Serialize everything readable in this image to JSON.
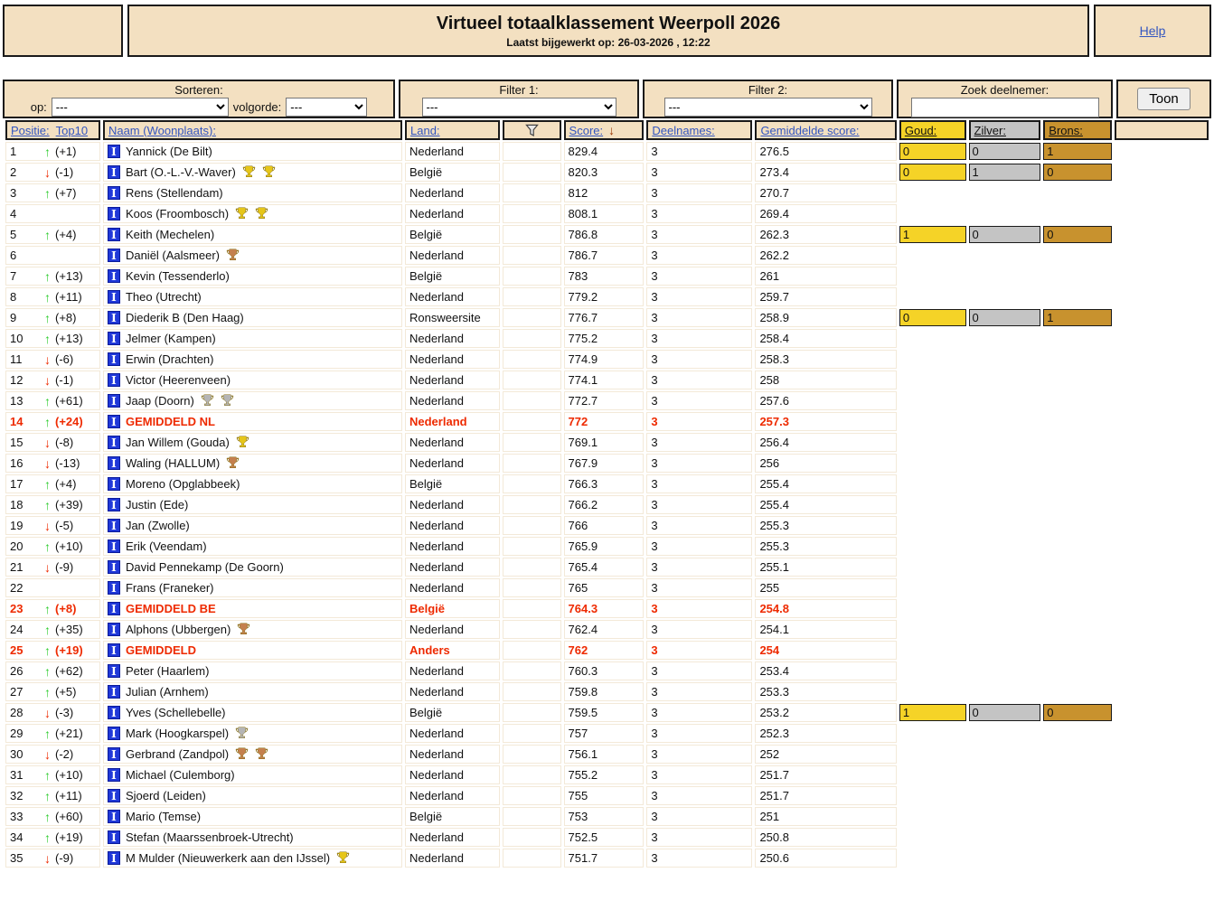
{
  "header": {
    "title": "Virtueel totaalklassement Weerpoll 2026",
    "subtitle": "Laatst bijgewerkt op: 26-03-2026 , 12:22",
    "help_label": "Help"
  },
  "controls": {
    "sorteren": {
      "label": "Sorteren:",
      "op_label": "op:",
      "op_value": "---",
      "volgorde_label": "volgorde:",
      "volgorde_value": "---"
    },
    "filter1": {
      "label": "Filter 1:",
      "value": "---"
    },
    "filter2": {
      "label": "Filter 2:",
      "value": "---"
    },
    "zoek": {
      "label": "Zoek deelnemer:",
      "value": ""
    },
    "toon_label": "Toon"
  },
  "icons": {
    "up_arrow": "↑",
    "down_arrow": "↓",
    "sort_desc_arrow": "↓",
    "funnel": "filter-funnel",
    "stat_glyph": "I"
  },
  "colors": {
    "beige": "#f3e0c1",
    "gold": "#f5d327",
    "silver": "#c4c4c4",
    "bronze": "#c8922e",
    "highlight_red": "#ee2a00",
    "up_green": "#2ecc2e",
    "link_blue": "#3356c0",
    "trophy_gold": "#e6c619",
    "trophy_silver": "#b5b5b5",
    "trophy_bronze": "#c4804e"
  },
  "table": {
    "headers": {
      "positie": "Positie:",
      "top10": "Top10",
      "naam": "Naam (Woonplaats):",
      "land": "Land:",
      "score": "Score:",
      "deelnames": "Deelnames:",
      "gemiddelde": "Gemiddelde score:",
      "goud": "Goud:",
      "zilver": "Zilver:",
      "brons": "Brons:"
    },
    "rows": [
      {
        "pos": "1",
        "dir": "up",
        "delta": "(+1)",
        "name": "Yannick (De Bilt)",
        "trophies": [],
        "land": "Nederland",
        "score": "829.4",
        "deelnames": "3",
        "avg": "276.5",
        "medals": [
          "0",
          "0",
          "1"
        ],
        "hl": false
      },
      {
        "pos": "2",
        "dir": "down",
        "delta": "(-1)",
        "name": "Bart (O.-L.-V.-Waver)",
        "trophies": [
          "gold",
          "gold"
        ],
        "land": "België",
        "score": "820.3",
        "deelnames": "3",
        "avg": "273.4",
        "medals": [
          "0",
          "1",
          "0"
        ],
        "hl": false
      },
      {
        "pos": "3",
        "dir": "up",
        "delta": "(+7)",
        "name": "Rens (Stellendam)",
        "trophies": [],
        "land": "Nederland",
        "score": "812",
        "deelnames": "3",
        "avg": "270.7",
        "medals": null,
        "hl": false
      },
      {
        "pos": "4",
        "dir": null,
        "delta": "",
        "name": "Koos (Froombosch)",
        "trophies": [
          "gold",
          "gold"
        ],
        "land": "Nederland",
        "score": "808.1",
        "deelnames": "3",
        "avg": "269.4",
        "medals": null,
        "hl": false
      },
      {
        "pos": "5",
        "dir": "up",
        "delta": "(+4)",
        "name": "Keith (Mechelen)",
        "trophies": [],
        "land": "België",
        "score": "786.8",
        "deelnames": "3",
        "avg": "262.3",
        "medals": [
          "1",
          "0",
          "0"
        ],
        "hl": false
      },
      {
        "pos": "6",
        "dir": null,
        "delta": "",
        "name": "Daniël (Aalsmeer)",
        "trophies": [
          "bronze"
        ],
        "land": "Nederland",
        "score": "786.7",
        "deelnames": "3",
        "avg": "262.2",
        "medals": null,
        "hl": false
      },
      {
        "pos": "7",
        "dir": "up",
        "delta": "(+13)",
        "name": "Kevin (Tessenderlo)",
        "trophies": [],
        "land": "België",
        "score": "783",
        "deelnames": "3",
        "avg": "261",
        "medals": null,
        "hl": false
      },
      {
        "pos": "8",
        "dir": "up",
        "delta": "(+11)",
        "name": "Theo (Utrecht)",
        "trophies": [],
        "land": "Nederland",
        "score": "779.2",
        "deelnames": "3",
        "avg": "259.7",
        "medals": null,
        "hl": false
      },
      {
        "pos": "9",
        "dir": "up",
        "delta": "(+8)",
        "name": "Diederik B (Den Haag)",
        "trophies": [],
        "land": "Ronsweersite",
        "score": "776.7",
        "deelnames": "3",
        "avg": "258.9",
        "medals": [
          "0",
          "0",
          "1"
        ],
        "hl": false
      },
      {
        "pos": "10",
        "dir": "up",
        "delta": "(+13)",
        "name": "Jelmer (Kampen)",
        "trophies": [],
        "land": "Nederland",
        "score": "775.2",
        "deelnames": "3",
        "avg": "258.4",
        "medals": null,
        "hl": false
      },
      {
        "pos": "11",
        "dir": "down",
        "delta": "(-6)",
        "name": "Erwin (Drachten)",
        "trophies": [],
        "land": "Nederland",
        "score": "774.9",
        "deelnames": "3",
        "avg": "258.3",
        "medals": null,
        "hl": false
      },
      {
        "pos": "12",
        "dir": "down",
        "delta": "(-1)",
        "name": "Victor (Heerenveen)",
        "trophies": [],
        "land": "Nederland",
        "score": "774.1",
        "deelnames": "3",
        "avg": "258",
        "medals": null,
        "hl": false
      },
      {
        "pos": "13",
        "dir": "up",
        "delta": "(+61)",
        "name": "Jaap (Doorn)",
        "trophies": [
          "silver",
          "silver"
        ],
        "land": "Nederland",
        "score": "772.7",
        "deelnames": "3",
        "avg": "257.6",
        "medals": null,
        "hl": false
      },
      {
        "pos": "14",
        "dir": "up",
        "delta": "(+24)",
        "name": "GEMIDDELD NL",
        "trophies": [],
        "land": "Nederland",
        "score": "772",
        "deelnames": "3",
        "avg": "257.3",
        "medals": null,
        "hl": true
      },
      {
        "pos": "15",
        "dir": "down",
        "delta": "(-8)",
        "name": "Jan Willem (Gouda)",
        "trophies": [
          "gold"
        ],
        "land": "Nederland",
        "score": "769.1",
        "deelnames": "3",
        "avg": "256.4",
        "medals": null,
        "hl": false
      },
      {
        "pos": "16",
        "dir": "down",
        "delta": "(-13)",
        "name": "Waling (HALLUM)",
        "trophies": [
          "bronze"
        ],
        "land": "Nederland",
        "score": "767.9",
        "deelnames": "3",
        "avg": "256",
        "medals": null,
        "hl": false
      },
      {
        "pos": "17",
        "dir": "up",
        "delta": "(+4)",
        "name": "Moreno (Opglabbeek)",
        "trophies": [],
        "land": "België",
        "score": "766.3",
        "deelnames": "3",
        "avg": "255.4",
        "medals": null,
        "hl": false
      },
      {
        "pos": "18",
        "dir": "up",
        "delta": "(+39)",
        "name": "Justin (Ede)",
        "trophies": [],
        "land": "Nederland",
        "score": "766.2",
        "deelnames": "3",
        "avg": "255.4",
        "medals": null,
        "hl": false
      },
      {
        "pos": "19",
        "dir": "down",
        "delta": "(-5)",
        "name": "Jan (Zwolle)",
        "trophies": [],
        "land": "Nederland",
        "score": "766",
        "deelnames": "3",
        "avg": "255.3",
        "medals": null,
        "hl": false
      },
      {
        "pos": "20",
        "dir": "up",
        "delta": "(+10)",
        "name": "Erik (Veendam)",
        "trophies": [],
        "land": "Nederland",
        "score": "765.9",
        "deelnames": "3",
        "avg": "255.3",
        "medals": null,
        "hl": false
      },
      {
        "pos": "21",
        "dir": "down",
        "delta": "(-9)",
        "name": "David Pennekamp (De Goorn)",
        "trophies": [],
        "land": "Nederland",
        "score": "765.4",
        "deelnames": "3",
        "avg": "255.1",
        "medals": null,
        "hl": false
      },
      {
        "pos": "22",
        "dir": null,
        "delta": "",
        "name": "Frans (Franeker)",
        "trophies": [],
        "land": "Nederland",
        "score": "765",
        "deelnames": "3",
        "avg": "255",
        "medals": null,
        "hl": false
      },
      {
        "pos": "23",
        "dir": "up",
        "delta": "(+8)",
        "name": "GEMIDDELD BE",
        "trophies": [],
        "land": "België",
        "score": "764.3",
        "deelnames": "3",
        "avg": "254.8",
        "medals": null,
        "hl": true
      },
      {
        "pos": "24",
        "dir": "up",
        "delta": "(+35)",
        "name": "Alphons (Ubbergen)",
        "trophies": [
          "bronze"
        ],
        "land": "Nederland",
        "score": "762.4",
        "deelnames": "3",
        "avg": "254.1",
        "medals": null,
        "hl": false
      },
      {
        "pos": "25",
        "dir": "up",
        "delta": "(+19)",
        "name": "GEMIDDELD",
        "trophies": [],
        "land": "Anders",
        "score": "762",
        "deelnames": "3",
        "avg": "254",
        "medals": null,
        "hl": true
      },
      {
        "pos": "26",
        "dir": "up",
        "delta": "(+62)",
        "name": "Peter (Haarlem)",
        "trophies": [],
        "land": "Nederland",
        "score": "760.3",
        "deelnames": "3",
        "avg": "253.4",
        "medals": null,
        "hl": false
      },
      {
        "pos": "27",
        "dir": "up",
        "delta": "(+5)",
        "name": "Julian (Arnhem)",
        "trophies": [],
        "land": "Nederland",
        "score": "759.8",
        "deelnames": "3",
        "avg": "253.3",
        "medals": null,
        "hl": false
      },
      {
        "pos": "28",
        "dir": "down",
        "delta": "(-3)",
        "name": "Yves (Schellebelle)",
        "trophies": [],
        "land": "België",
        "score": "759.5",
        "deelnames": "3",
        "avg": "253.2",
        "medals": [
          "1",
          "0",
          "0"
        ],
        "hl": false
      },
      {
        "pos": "29",
        "dir": "up",
        "delta": "(+21)",
        "name": "Mark (Hoogkarspel)",
        "trophies": [
          "silver"
        ],
        "land": "Nederland",
        "score": "757",
        "deelnames": "3",
        "avg": "252.3",
        "medals": null,
        "hl": false
      },
      {
        "pos": "30",
        "dir": "down",
        "delta": "(-2)",
        "name": "Gerbrand (Zandpol)",
        "trophies": [
          "bronze",
          "bronze"
        ],
        "land": "Nederland",
        "score": "756.1",
        "deelnames": "3",
        "avg": "252",
        "medals": null,
        "hl": false
      },
      {
        "pos": "31",
        "dir": "up",
        "delta": "(+10)",
        "name": "Michael (Culemborg)",
        "trophies": [],
        "land": "Nederland",
        "score": "755.2",
        "deelnames": "3",
        "avg": "251.7",
        "medals": null,
        "hl": false
      },
      {
        "pos": "32",
        "dir": "up",
        "delta": "(+11)",
        "name": "Sjoerd (Leiden)",
        "trophies": [],
        "land": "Nederland",
        "score": "755",
        "deelnames": "3",
        "avg": "251.7",
        "medals": null,
        "hl": false
      },
      {
        "pos": "33",
        "dir": "up",
        "delta": "(+60)",
        "name": "Mario (Temse)",
        "trophies": [],
        "land": "België",
        "score": "753",
        "deelnames": "3",
        "avg": "251",
        "medals": null,
        "hl": false
      },
      {
        "pos": "34",
        "dir": "up",
        "delta": "(+19)",
        "name": "Stefan (Maarssenbroek-Utrecht)",
        "trophies": [],
        "land": "Nederland",
        "score": "752.5",
        "deelnames": "3",
        "avg": "250.8",
        "medals": null,
        "hl": false
      },
      {
        "pos": "35",
        "dir": "down",
        "delta": "(-9)",
        "name": "M Mulder (Nieuwerkerk aan den IJssel)",
        "trophies": [
          "gold"
        ],
        "land": "Nederland",
        "score": "751.7",
        "deelnames": "3",
        "avg": "250.6",
        "medals": null,
        "hl": false
      }
    ]
  }
}
